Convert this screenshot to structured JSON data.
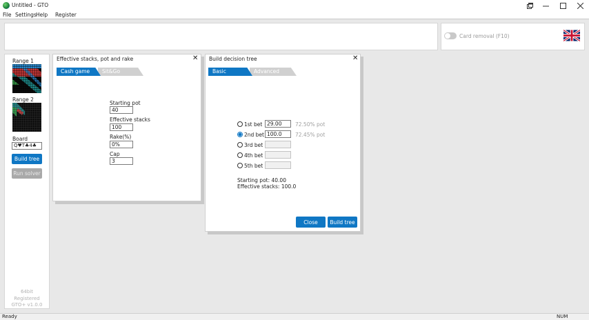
{
  "window": {
    "title": "Untitled - GTO"
  },
  "menu": [
    "File",
    "Settings",
    "Help",
    "Register"
  ],
  "top": {
    "card_removal_label": "Card removal (F10)"
  },
  "sidebar": {
    "range1_label": "Range 1",
    "range2_label": "Range 2",
    "board_label": "Board",
    "board_value": "Q♥T♣4♣",
    "build_tree_label": "Build tree",
    "run_solver_label": "Run solver",
    "footer": [
      "64bit",
      "Registered",
      "GTO+ v1.0.0"
    ]
  },
  "stacks_dialog": {
    "title": "Effective stacks, pot and rake",
    "tabs": [
      "Cash game",
      "Sit&Go"
    ],
    "fields": [
      {
        "label": "Starting pot",
        "value": "40"
      },
      {
        "label": "Effective stacks",
        "value": "100"
      },
      {
        "label": "Rake(%)",
        "value": "0%"
      },
      {
        "label": "Cap",
        "value": "3"
      }
    ]
  },
  "tree_dialog": {
    "title": "Build decision tree",
    "tabs": [
      "Basic",
      "Advanced"
    ],
    "bets": [
      {
        "label": "1st bet",
        "value": "29.00",
        "pct": "72.50% pot",
        "selected": false
      },
      {
        "label": "2nd bet",
        "value": "100.0",
        "pct": "72.45% pot",
        "selected": true
      },
      {
        "label": "3rd bet",
        "value": "",
        "pct": "",
        "selected": false
      },
      {
        "label": "4th bet",
        "value": "",
        "pct": "",
        "selected": false
      },
      {
        "label": "5th bet",
        "value": "",
        "pct": "",
        "selected": false
      }
    ],
    "starting_pot": "Starting pot: 40.00",
    "effective_stacks": "Effective stacks: 100.0",
    "close_label": "Close",
    "build_label": "Build tree"
  },
  "status": {
    "left": "Ready",
    "right": "NUM"
  },
  "colors": {
    "accent": "#0f77c4",
    "disabled": "#a9a9a9"
  }
}
